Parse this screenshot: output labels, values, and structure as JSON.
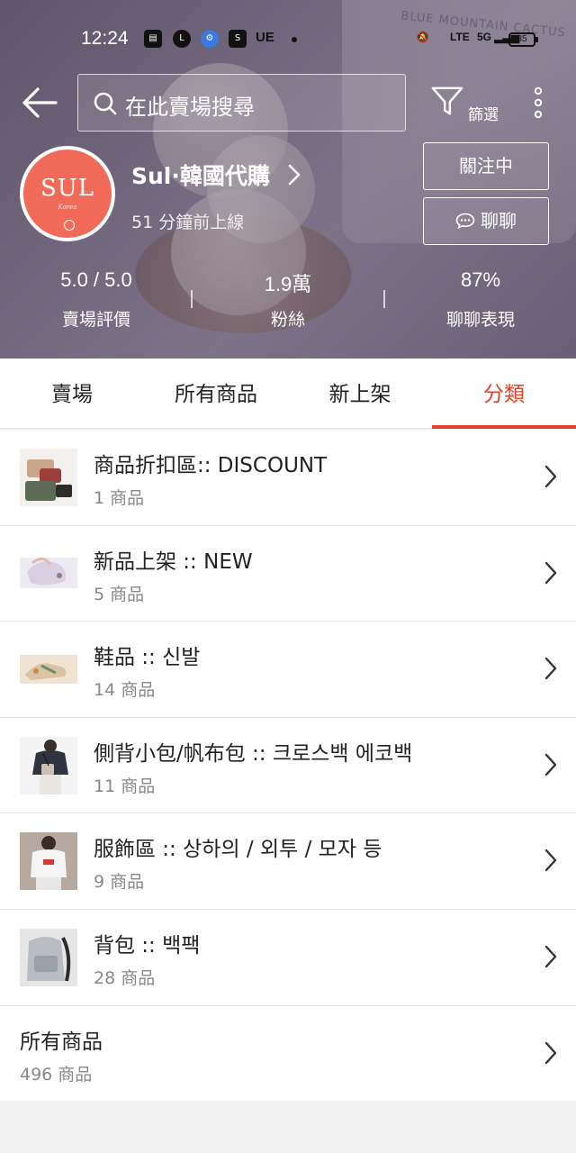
{
  "status_bar": {
    "time": "12:24",
    "carrier": "UE",
    "battery": "85",
    "network": "5G"
  },
  "header": {
    "search_placeholder": "在此賣場搜尋",
    "filter_label": "篩選",
    "background_jar_text": "BLUE MOUNTAIN CACTUS"
  },
  "shop": {
    "name": "Sul·韓國代購",
    "logo_text": "SUL",
    "logo_sub": "Korea",
    "last_online": "51 分鐘前上線",
    "follow_label": "關注中",
    "chat_label": "聊聊",
    "stats": [
      {
        "value": "5.0 / 5.0",
        "label": "賣場評價"
      },
      {
        "value": "1.9萬",
        "label": "粉絲"
      },
      {
        "value": "87%",
        "label": "聊聊表現"
      }
    ]
  },
  "tabs": [
    {
      "label": "賣場",
      "active": false
    },
    {
      "label": "所有商品",
      "active": false
    },
    {
      "label": "新上架",
      "active": false
    },
    {
      "label": "分類",
      "active": true
    }
  ],
  "categories": [
    {
      "title": "商品折扣區:: DISCOUNT",
      "count": "1 商品",
      "thumb": "wallet-photo"
    },
    {
      "title": "新品上架 :: NEW",
      "count": "5 商品",
      "thumb": "bag-photo"
    },
    {
      "title": "鞋品 :: 신발",
      "count": "14 商品",
      "thumb": "shoe-photo"
    },
    {
      "title": "側背小包/帆布包 :: 크로스백 에코백",
      "count": "11 商品",
      "thumb": "crossbag-photo"
    },
    {
      "title": "服飾區 :: 상하의 / 외투 / 모자 등",
      "count": "9 商品",
      "thumb": "clothing-photo"
    },
    {
      "title": "背包 :: 백팩",
      "count": "28 商品",
      "thumb": "backpack-photo"
    }
  ],
  "all_products": {
    "title": "所有商品",
    "count": "496 商品"
  },
  "colors": {
    "accent": "#e0442b",
    "logo_bg": "#f26b58"
  }
}
